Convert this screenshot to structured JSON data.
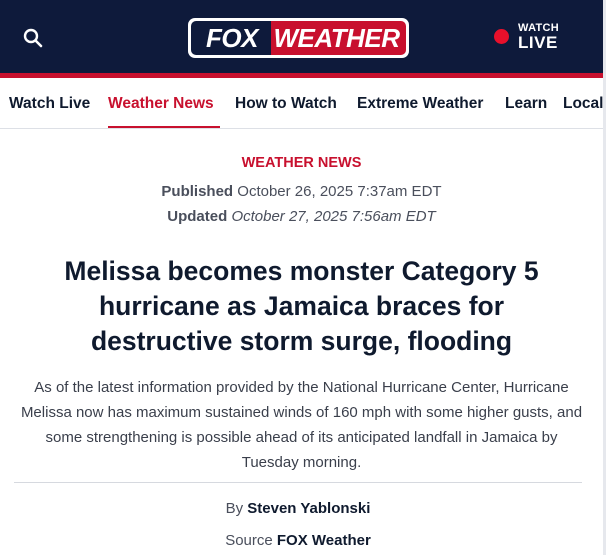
{
  "header": {
    "logo_fox": "FOX",
    "logo_weather": "WEATHER",
    "watch_label": "WATCH",
    "live_label": "LIVE",
    "icons": {
      "search": "search-icon",
      "live": "live-dot-icon"
    },
    "colors": {
      "navy": "#0e1a3b",
      "red": "#c8102e",
      "live_dot": "#e8102b"
    }
  },
  "nav": {
    "items": [
      {
        "label": "Watch Live",
        "active": false
      },
      {
        "label": "Weather News",
        "active": true
      },
      {
        "label": "How to Watch",
        "active": false
      },
      {
        "label": "Extreme Weather",
        "active": false
      },
      {
        "label": "Learn",
        "active": false
      },
      {
        "label": "Local",
        "active": false
      }
    ]
  },
  "article": {
    "category": "WEATHER NEWS",
    "published_label": "Published",
    "published_value": "October 26, 2025 7:37am EDT",
    "updated_label": "Updated",
    "updated_value": "October 27, 2025 7:56am EDT",
    "headline": "Melissa becomes monster Category 5 hurricane as Jamaica braces for destructive storm surge, flooding",
    "summary": "As of the latest information provided by the National Hurricane Center, Hurricane Melissa now has maximum sustained winds of 160 mph with some higher gusts, and some strengthening is possible ahead of its anticipated landfall in Jamaica by Tuesday morning.",
    "by_label": "By",
    "author": "Steven Yablonski",
    "source_label": "Source",
    "source": "FOX Weather"
  }
}
